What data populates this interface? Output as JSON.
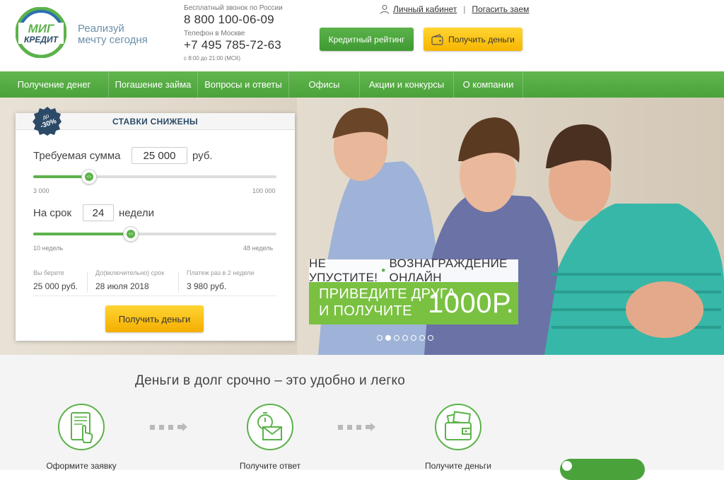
{
  "brand": {
    "logo_top": "МИГ",
    "logo_bottom": "КРЕДИТ",
    "slogan_line1": "Реализуй",
    "slogan_line2": "мечту сегодня"
  },
  "contacts": {
    "free_call_label": "Бесплатный звонок по России",
    "free_call_number": "8 800 100-06-09",
    "moscow_label": "Телефон в Москве",
    "moscow_number": "+7 495 785-72-63",
    "hours": "с 8:00 до 21:00 (МСК)"
  },
  "toplinks": {
    "cabinet": "Личный кабинет",
    "separator": "|",
    "repay": "Погасить заем"
  },
  "header_buttons": {
    "rating": "Кредитный рейтинг",
    "get_money": "Получить деньги"
  },
  "nav": [
    {
      "label": "Получение денег"
    },
    {
      "label": "Погашение займа"
    },
    {
      "label": "Вопросы и ответы"
    },
    {
      "label": "Офисы"
    },
    {
      "label": "Акции и конкурсы"
    },
    {
      "label": "О компании"
    }
  ],
  "calculator": {
    "header": "СТАВКИ СНИЖЕНЫ",
    "badge_top": "до",
    "badge_value": "-30%",
    "amount_label": "Требуемая сумма",
    "amount_value": "25 000",
    "amount_unit": "руб.",
    "amount_min": "3 000",
    "amount_max": "100 000",
    "amount_fraction": 0.23,
    "term_label": "На срок",
    "term_value": "24",
    "term_unit": "недели",
    "term_min": "10 недель",
    "term_max": "48 недель",
    "term_fraction": 0.4,
    "summary": [
      {
        "key": "Вы берете",
        "value": "25 000 руб."
      },
      {
        "key": "До(включительно) срок",
        "value": "28 июля 2018"
      },
      {
        "key": "Платеж раз в 2 недели",
        "value": "3 980 руб."
      }
    ],
    "button": "Получить деньги"
  },
  "promo": {
    "line_left": "НЕ УПУСТИТЕ!",
    "dot": "•",
    "line_right": "ВОЗНАГРАЖДЕНИЕ ОНЛАЙН",
    "green_line1": "ПРИВЕДИТЕ ДРУГА",
    "green_line2": "И ПОЛУЧИТЕ",
    "amount": "1000Р."
  },
  "slider": {
    "count": 7,
    "active_index": 1
  },
  "lower": {
    "heading": "Деньги в долг срочно – это удобно и легко",
    "steps": [
      {
        "label": "Оформите заявку",
        "icon": "tablet-hand-icon"
      },
      {
        "label": "Получите ответ",
        "icon": "stopwatch-envelope-icon"
      },
      {
        "label": "Получите деньги",
        "icon": "wallet-cash-icon"
      }
    ]
  },
  "colors": {
    "green": "#5cb24a",
    "yellow": "#ffd533",
    "navy": "#2b4a67",
    "promo_green": "#7ac142"
  }
}
